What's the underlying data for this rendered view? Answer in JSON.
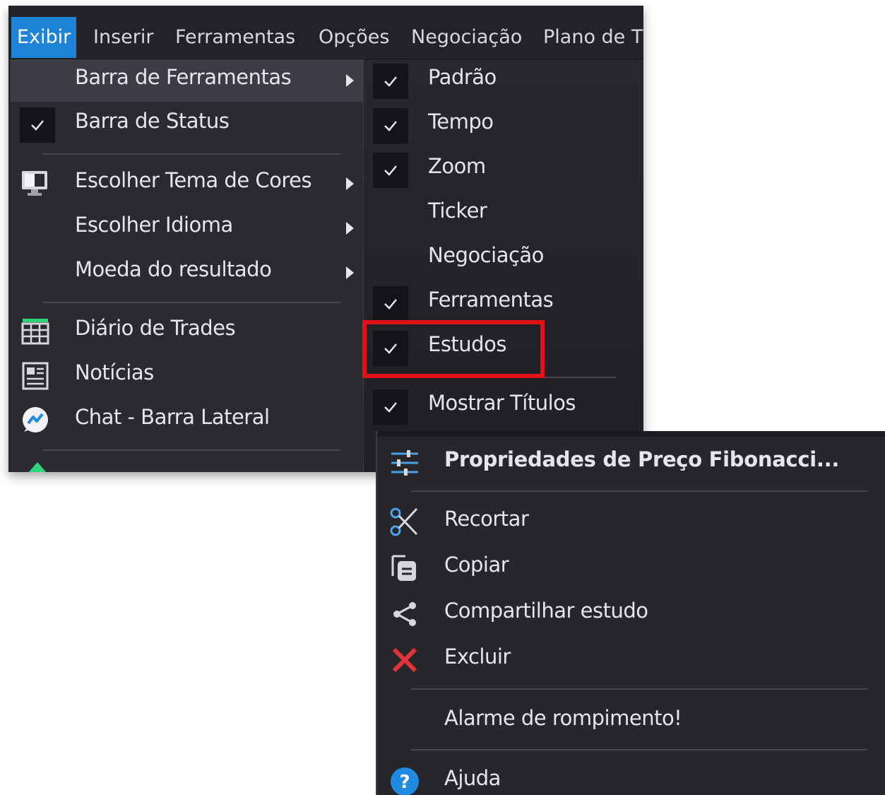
{
  "menubar": {
    "items": [
      "Exibir",
      "Inserir",
      "Ferramentas",
      "Opções",
      "Negociação",
      "Plano de T"
    ]
  },
  "view_menu": {
    "items": [
      {
        "label": "Barra de Ferramentas",
        "submenu": true,
        "highlighted": true
      },
      {
        "label": "Barra de Status",
        "checked": true
      },
      {
        "label": "Escolher Tema de Cores",
        "icon": "monitor-icon",
        "submenu": true
      },
      {
        "label": "Escolher Idioma",
        "submenu": true
      },
      {
        "label": "Moeda do resultado",
        "submenu": true
      },
      {
        "label": "Diário de Trades",
        "icon": "calendar-grid-icon"
      },
      {
        "label": "Notícias",
        "icon": "newspaper-icon"
      },
      {
        "label": "Chat - Barra Lateral",
        "icon": "chat-icon"
      }
    ]
  },
  "toolbar_submenu": {
    "items": [
      {
        "label": "Padrão",
        "checked": true
      },
      {
        "label": "Tempo",
        "checked": true
      },
      {
        "label": "Zoom",
        "checked": true
      },
      {
        "label": "Ticker",
        "checked": false
      },
      {
        "label": "Negociação",
        "checked": false
      },
      {
        "label": "Ferramentas",
        "checked": true
      },
      {
        "label": "Estudos",
        "checked": true,
        "highlighted_annotation": true
      },
      {
        "label": "Mostrar Títulos",
        "checked": true
      }
    ]
  },
  "context_menu": {
    "title": "Propriedades de Preço Fibonacci...",
    "items": [
      {
        "label": "Recortar",
        "icon": "scissors-icon"
      },
      {
        "label": "Copiar",
        "icon": "copy-icon"
      },
      {
        "label": "Compartilhar estudo",
        "icon": "share-icon"
      },
      {
        "label": "Excluir",
        "icon": "delete-x-icon"
      },
      {
        "label": "Alarme de rompimento!"
      },
      {
        "label": "Ajuda",
        "icon": "help-icon"
      }
    ]
  },
  "colors": {
    "menu_bg": "#2a2a30",
    "active_menubar": "#1e82d6",
    "annotation_red": "#e3101a",
    "delete_red": "#e0343a",
    "help_blue": "#1e8be0"
  }
}
